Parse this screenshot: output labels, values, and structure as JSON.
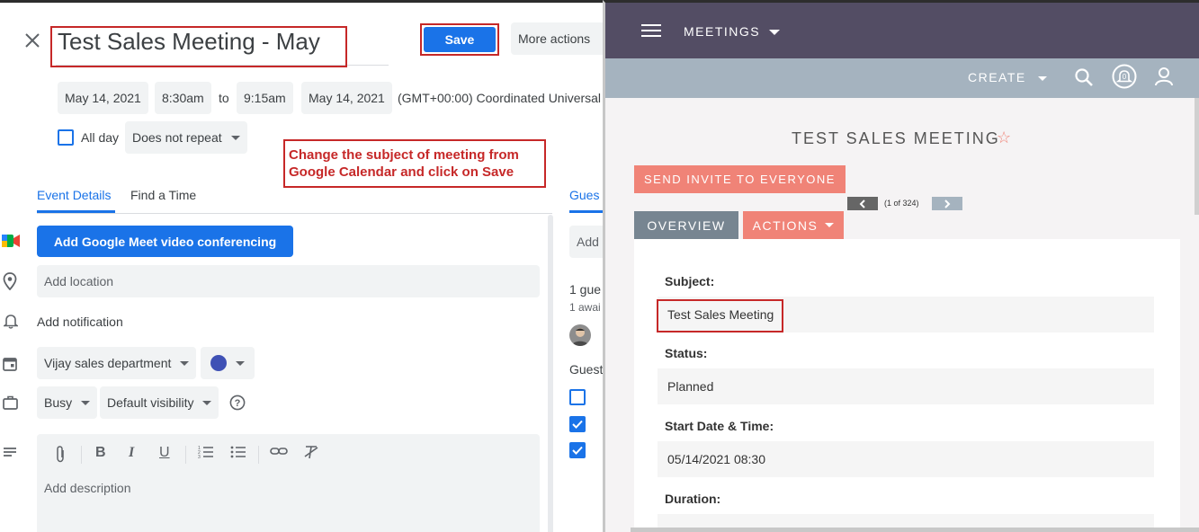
{
  "calendar": {
    "close_icon": "close-icon",
    "title": "Test Sales Meeting - May",
    "save_label": "Save",
    "more_actions_label": "More actions",
    "start_date": "May 14, 2021",
    "start_time": "8:30am",
    "to_label": "to",
    "end_time": "9:15am",
    "end_date": "May 14, 2021",
    "timezone": "(GMT+00:00) Coordinated Universal",
    "all_day_label": "All day",
    "repeat_label": "Does not repeat",
    "annotation_text": "Change the subject of meeting from Google Calendar and click on Save",
    "tabs": [
      {
        "label": "Event Details"
      },
      {
        "label": "Find a Time"
      }
    ],
    "guests_tab_label": "Gues",
    "meet_button_label": "Add Google Meet video conferencing",
    "location_placeholder": "Add location",
    "notification_label": "Add notification",
    "calendar_name": "Vijay sales department",
    "calendar_color": "#3f51b5",
    "busy_label": "Busy",
    "visibility_label": "Default visibility",
    "description_placeholder": "Add description",
    "guests": {
      "add_placeholder": "Add",
      "count_label": "1 gue",
      "awaiting_label": "1 awai",
      "permissions_label": "Guest"
    },
    "colors": {
      "accent": "#1a73e8",
      "annotation_red": "#c62828"
    }
  },
  "crm": {
    "module_label": "MEETINGS",
    "create_label": "CREATE",
    "record_title": "TEST SALES MEETING",
    "send_invite_label": "SEND INVITE TO EVERYONE",
    "pagination_label": "(1 of 324)",
    "tabs": [
      {
        "label": "OVERVIEW"
      },
      {
        "label": "ACTIONS"
      }
    ],
    "fields": {
      "subject_label": "Subject:",
      "subject_value": "Test Sales Meeting",
      "status_label": "Status:",
      "status_value": "Planned",
      "start_label": "Start Date & Time:",
      "start_value": "05/14/2021 08:30",
      "duration_label": "Duration:"
    },
    "colors": {
      "header": "#534d64",
      "subheader": "#a5b3bf",
      "salmon": "#f08377"
    }
  }
}
